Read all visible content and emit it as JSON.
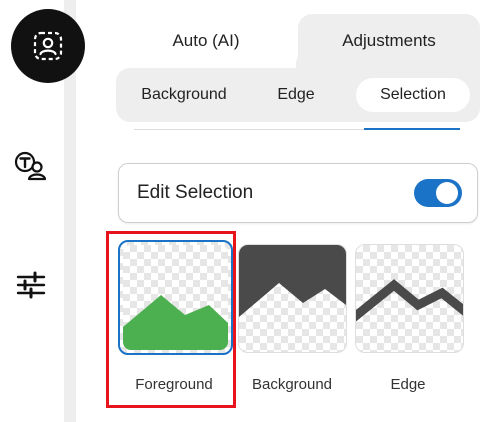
{
  "rail": {
    "items": [
      {
        "icon": "portrait-selection-icon",
        "active": true
      },
      {
        "icon": "text-people-icon",
        "active": false
      },
      {
        "icon": "sliders-icon",
        "active": false
      }
    ]
  },
  "tabs": {
    "top": [
      {
        "label": "Auto (AI)",
        "selected": false
      },
      {
        "label": "Adjustments",
        "selected": true
      }
    ],
    "sub": [
      {
        "label": "Background",
        "selected": false
      },
      {
        "label": "Edge",
        "selected": false
      },
      {
        "label": "Selection",
        "selected": true
      }
    ]
  },
  "edit_selection": {
    "label": "Edit Selection",
    "enabled": true
  },
  "modes": [
    {
      "label": "Foreground",
      "selected": true
    },
    {
      "label": "Background",
      "selected": false
    },
    {
      "label": "Edge",
      "selected": false
    }
  ],
  "colors": {
    "accent": "#1a73c7",
    "foreground_green": "#4caf50",
    "background_dark": "#4a4a4a",
    "highlight_red": "#e8141c"
  }
}
